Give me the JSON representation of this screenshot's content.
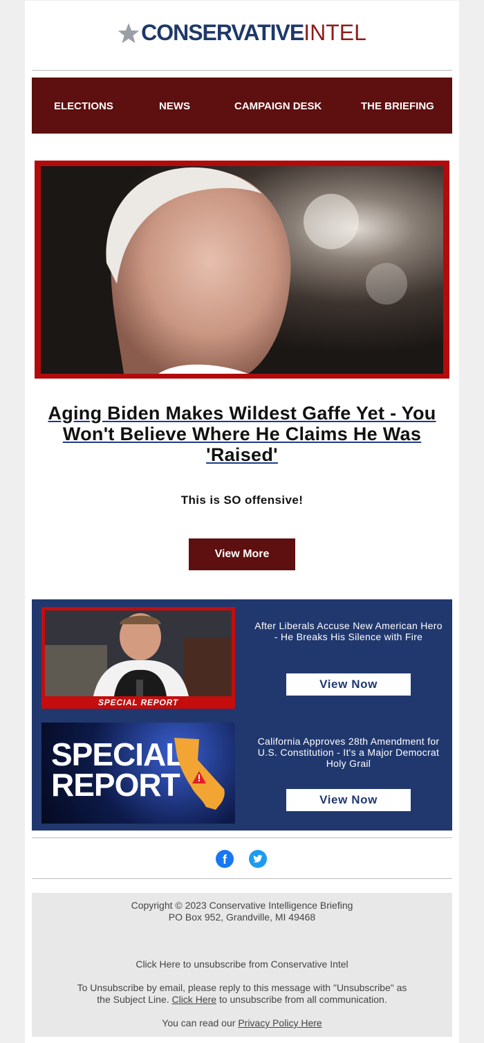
{
  "brand": {
    "word1": "CONSERVATIVE",
    "word2": "INTEL",
    "colors": {
      "navy": "#1e3868",
      "maroon": "#8f1c1c",
      "nav_bg": "#5e0f0f",
      "feature_bg": "#21386f",
      "hero_border": "#b30b0b"
    }
  },
  "nav": {
    "items": [
      "ELECTIONS",
      "NEWS",
      "CAMPAIGN DESK",
      "THE BRIEFING"
    ]
  },
  "hero": {
    "headline": "Aging Biden Makes Wildest Gaffe Yet - You Won't Believe Where He Claims He Was 'Raised'",
    "teaser": "This is SO offensive!",
    "button_label": "View More"
  },
  "features": [
    {
      "thumb_caption": "SPECIAL REPORT",
      "text": "After Liberals Accuse New American Hero - He Breaks His Silence with Fire",
      "button_label": "View Now"
    },
    {
      "thumb_title": "SPECIAL REPORT",
      "text": "California Approves 28th Amendment for U.S. Constitution - It's a Major Democrat Holy Grail",
      "button_label": "View Now"
    }
  ],
  "social": [
    "facebook-icon",
    "twitter-icon"
  ],
  "footer": {
    "copyright": "Copyright © 2023 Conservative Intelligence Briefing",
    "address": "PO Box 952, Grandville, MI 49468",
    "unsubscribe_line": "Click Here to unsubscribe from Conservative Intel",
    "email_unsub_part1": "To Unsubscribe by email, please reply to this message with \"Unsubscribe\" as",
    "email_unsub_part2a": "the Subject Line.",
    "email_unsub_link": "Click Here",
    "email_unsub_part2b": "to unsubscribe from all communication.",
    "privacy_prefix": "You can read our",
    "privacy_link": "Privacy Policy Here"
  }
}
